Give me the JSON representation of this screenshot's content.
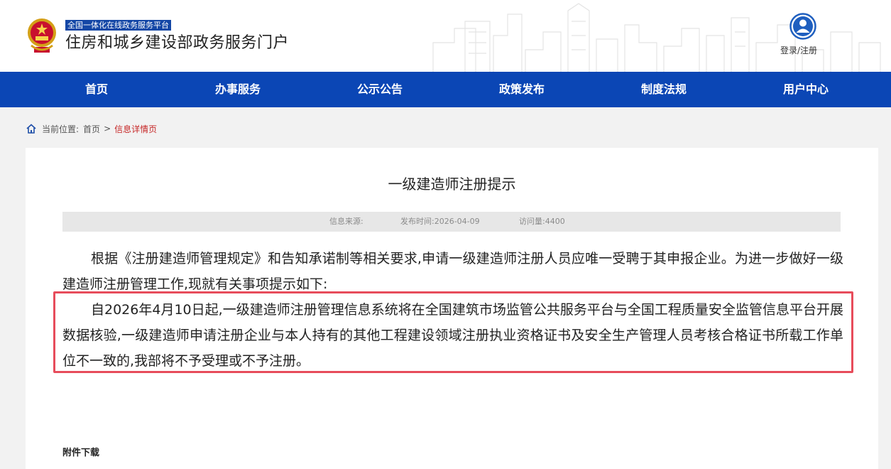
{
  "header": {
    "platform_tag": "全国一体化在线政务服务平台",
    "portal_title": "住房和城乡建设部政务服务门户",
    "login_text": "登录/注册",
    "emblem_icon": "national-emblem-icon",
    "avatar_icon": "user-avatar-icon"
  },
  "nav": {
    "items": [
      {
        "label": "首页"
      },
      {
        "label": "办事服务"
      },
      {
        "label": "公示公告"
      },
      {
        "label": "政策发布"
      },
      {
        "label": "制度法规"
      },
      {
        "label": "用户中心"
      }
    ]
  },
  "breadcrumb": {
    "prefix": "当前位置:",
    "home": "首页",
    "separator": ">",
    "current": "信息详情页"
  },
  "article": {
    "title": "一级建造师注册提示",
    "meta": {
      "source": "信息来源:",
      "publish_time": "发布时间:2026-04-09",
      "views": "访问量:4400"
    },
    "paragraphs": [
      "根据《注册建造师管理规定》和告知承诺制等相关要求,申请一级建造师注册人员应唯一受聘于其申报企业。为进一步做好一级建造师注册管理工作,现就有关事项提示如下:",
      "自2026年4月10日起,一级建造师注册管理信息系统将在全国建筑市场监管公共服务平台与全国工程质量安全监管信息平台开展数据核验,一级建造师申请注册企业与本人持有的其他工程建设领域注册执业资格证书及安全生产管理人员考核合格证书所载工作单位不一致的,我部将不予受理或不予注册。"
    ],
    "attachment_label": "附件下载"
  },
  "colors": {
    "nav_bg": "#0b46b5",
    "tag_bg": "#1447a6",
    "highlight_border": "#e74c5b",
    "breadcrumb_current": "#c62828"
  }
}
